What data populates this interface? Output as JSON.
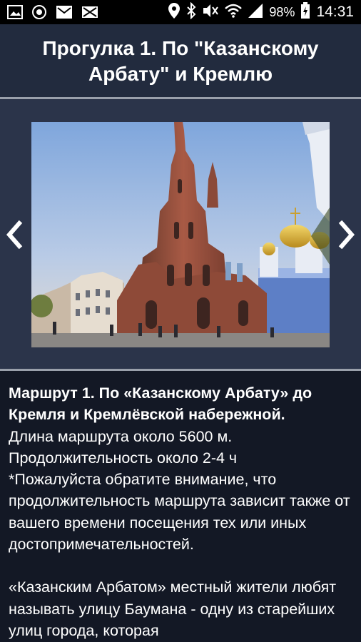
{
  "status_bar": {
    "battery": "98%",
    "time": "14:31",
    "icons": [
      "gallery-icon",
      "settings-icon",
      "mail-icon",
      "email-icon",
      "location-icon",
      "bluetooth-icon",
      "mute-icon",
      "wifi-icon",
      "signal-icon",
      "battery-icon"
    ]
  },
  "header": {
    "title": "Прогулка 1. По \"Казанскому Арбату\" и Кремлю"
  },
  "gallery": {
    "prev_icon": "chevron-left-icon",
    "next_icon": "chevron-right-icon"
  },
  "description": {
    "heading": "Маршрут 1. По «Казанскому Арбату» до Кремля и Кремлёвской набережной.",
    "length": "Длина маршрута около 5600 м.",
    "duration": "Продолжительность около 2-4 ч",
    "note": "*Пожалуйста обратите внимание, что продолжительность маршрута зависит также от вашего времени посещения тех или иных достопримечательностей.",
    "paragraph": "«Казанским Арбатом» местный жители любят называть улицу Баумана - одну из старейших улиц города, которая"
  },
  "colors": {
    "status_bar": "#000000",
    "header_bg": "#222b3e",
    "gallery_bg": "#2b344a",
    "desc_bg": "#131825",
    "divider": "#9aa0ab"
  }
}
